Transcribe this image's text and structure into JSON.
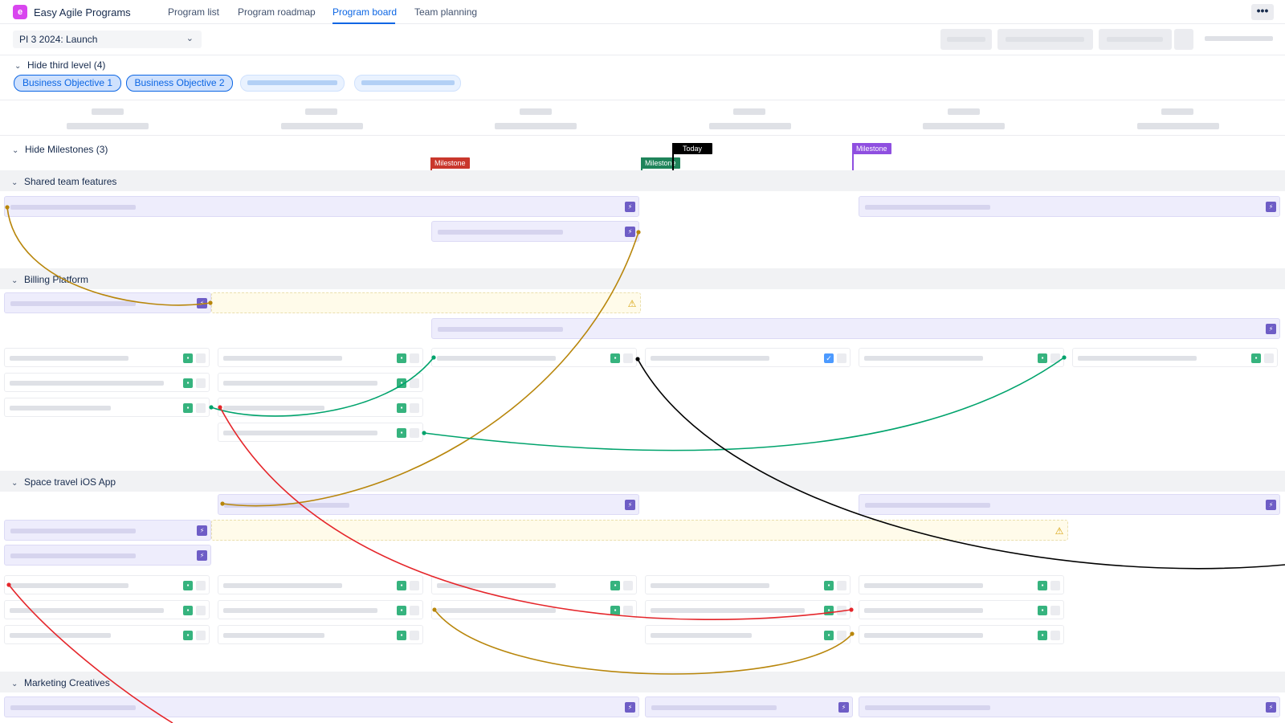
{
  "app": {
    "logo_letter": "e",
    "title": "Easy Agile Programs",
    "more_label": "•••"
  },
  "nav": {
    "tabs": [
      {
        "label": "Program list"
      },
      {
        "label": "Program roadmap"
      },
      {
        "label": "Program board"
      },
      {
        "label": "Team planning"
      }
    ],
    "active_tab": "Program board"
  },
  "toolbar": {
    "pi_selected": "PI 3 2024: Launch"
  },
  "objectives": {
    "toggle_label": "Hide third level (4)",
    "items": [
      {
        "label": "Business Objective 1"
      },
      {
        "label": "Business Objective 2"
      }
    ]
  },
  "milestones": {
    "toggle_label": "Hide Milestones (3)",
    "flags": [
      {
        "label": "Milestone",
        "color": "#c9372c"
      },
      {
        "label": "Milestone",
        "color": "#1f845a"
      },
      {
        "label": "Today",
        "color": "#000000"
      },
      {
        "label": "Milestone",
        "color": "#8f4fe0"
      }
    ]
  },
  "sections": [
    {
      "label": "Shared team features"
    },
    {
      "label": "Billing Platform"
    },
    {
      "label": "Space travel iOS App"
    },
    {
      "label": "Marketing Creatives"
    }
  ],
  "icons": {
    "feature": "lightning-icon",
    "warning": "warning-icon",
    "story": "story-icon",
    "task": "task-check-icon",
    "chevron": "chevron-down-icon"
  },
  "colors": {
    "accent": "#0c66e4",
    "feature": "#eeedfc",
    "dep_gold": "#b8860b",
    "dep_green": "#00a36c",
    "dep_red": "#e5262b",
    "dep_black": "#000000"
  }
}
